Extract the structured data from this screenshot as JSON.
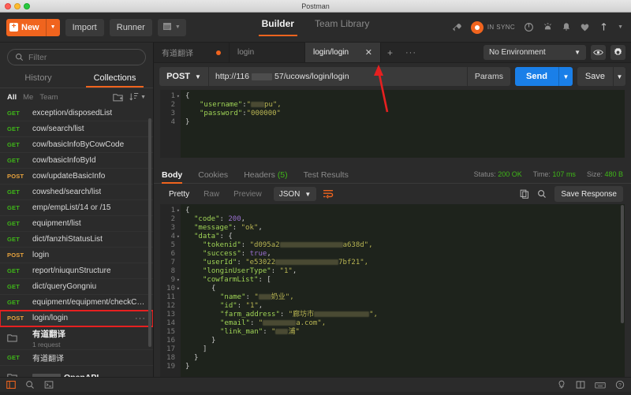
{
  "window": {
    "title": "Postman"
  },
  "topnav": {
    "new_label": "New",
    "import_label": "Import",
    "runner_label": "Runner",
    "tabs": [
      {
        "label": "Builder",
        "active": true
      },
      {
        "label": "Team Library",
        "active": false
      }
    ],
    "sync_status": "IN SYNC",
    "icons": [
      "broadcast-icon",
      "sync-icon",
      "refresh-icon",
      "notification-bell-icon",
      "alarm-bell-icon",
      "heart-icon",
      "upload-icon"
    ]
  },
  "sidebar": {
    "filter_placeholder": "Filter",
    "tabs": [
      {
        "label": "History",
        "active": false
      },
      {
        "label": "Collections",
        "active": true
      }
    ],
    "scope_filters": [
      {
        "label": "All",
        "active": true
      },
      {
        "label": "Me",
        "active": false
      },
      {
        "label": "Team",
        "active": false
      }
    ],
    "items": [
      {
        "type": "request",
        "method": "GET",
        "name": "exception/disposedList"
      },
      {
        "type": "request",
        "method": "GET",
        "name": "cow/search/list"
      },
      {
        "type": "request",
        "method": "GET",
        "name": "cow/basicInfoByCowCode"
      },
      {
        "type": "request",
        "method": "GET",
        "name": "cow/basicInfoById"
      },
      {
        "type": "request",
        "method": "POST",
        "name": "cow/updateBasicInfo"
      },
      {
        "type": "request",
        "method": "GET",
        "name": "cowshed/search/list"
      },
      {
        "type": "request",
        "method": "GET",
        "name": "emp/empList/14 or /15"
      },
      {
        "type": "request",
        "method": "GET",
        "name": "equipment/list"
      },
      {
        "type": "request",
        "method": "GET",
        "name": "dict/fanzhiStatusList"
      },
      {
        "type": "request",
        "method": "POST",
        "name": "login"
      },
      {
        "type": "request",
        "method": "GET",
        "name": "report/niuqunStructure"
      },
      {
        "type": "request",
        "method": "GET",
        "name": "dict/queryGongniu"
      },
      {
        "type": "request",
        "method": "GET",
        "name": "equipment/equipment/checkCowfa..."
      },
      {
        "type": "request",
        "method": "POST",
        "name": "login/login",
        "selected": true,
        "more": "···"
      },
      {
        "type": "folder",
        "name": "有道翻译",
        "subtitle": "1 request"
      },
      {
        "type": "request",
        "method": "GET",
        "name": "有道翻译"
      },
      {
        "type": "folder",
        "name": "OpenAPI",
        "redacted_prefix": true
      }
    ]
  },
  "request": {
    "tabs": [
      {
        "label": "有道翻译",
        "active": false,
        "unsaved": true
      },
      {
        "label": "login",
        "active": false,
        "unsaved": false
      },
      {
        "label": "login/login",
        "active": true,
        "closable": true
      }
    ],
    "add_tab": "+",
    "more_tabs": "···",
    "environment": "No Environment",
    "method": "POST",
    "url": "http://116        57/ucows/login/login",
    "url_prefix": "http://116",
    "url_suffix": "57/ucows/login/login",
    "params_label": "Params",
    "send_label": "Send",
    "save_label": "Save",
    "body_lines": [
      {
        "n": 1,
        "fold": true,
        "text": "{"
      },
      {
        "n": 2,
        "fold": false,
        "text": "    \"username\":\"____pu\","
      },
      {
        "n": 3,
        "fold": false,
        "text": "    \"password\":\"000000\""
      },
      {
        "n": 4,
        "fold": false,
        "text": "}"
      }
    ],
    "body_username_key": "\"username\"",
    "body_password_key": "\"password\"",
    "body_password_value": "\"000000\"",
    "body_username_tail": "pu\","
  },
  "response": {
    "tabs": [
      {
        "label": "Body",
        "active": true
      },
      {
        "label": "Cookies",
        "active": false
      },
      {
        "label": "Headers",
        "count": "(5)",
        "active": false
      },
      {
        "label": "Test Results",
        "active": false
      }
    ],
    "status_label": "Status:",
    "status_value": "200 OK",
    "time_label": "Time:",
    "time_value": "107 ms",
    "size_label": "Size:",
    "size_value": "480 B",
    "formats": [
      {
        "label": "Pretty",
        "active": true
      },
      {
        "label": "Raw",
        "active": false
      },
      {
        "label": "Preview",
        "active": false
      }
    ],
    "language": "JSON",
    "save_response_label": "Save Response",
    "body_lines": [
      {
        "n": 1,
        "fold": true,
        "indent": 0,
        "tokens": [
          {
            "t": "{",
            "c": "p"
          }
        ]
      },
      {
        "n": 2,
        "fold": false,
        "indent": 1,
        "tokens": [
          {
            "t": "\"code\"",
            "c": "k"
          },
          {
            "t": ": ",
            "c": "p"
          },
          {
            "t": "200",
            "c": "n"
          },
          {
            "t": ",",
            "c": "p"
          }
        ]
      },
      {
        "n": 3,
        "fold": false,
        "indent": 1,
        "tokens": [
          {
            "t": "\"message\"",
            "c": "k"
          },
          {
            "t": ": ",
            "c": "p"
          },
          {
            "t": "\"ok\"",
            "c": "s"
          },
          {
            "t": ",",
            "c": "p"
          }
        ]
      },
      {
        "n": 4,
        "fold": true,
        "indent": 1,
        "tokens": [
          {
            "t": "\"data\"",
            "c": "k"
          },
          {
            "t": ": {",
            "c": "p"
          }
        ]
      },
      {
        "n": 5,
        "fold": false,
        "indent": 2,
        "tokens": [
          {
            "t": "\"tokenid\"",
            "c": "k"
          },
          {
            "t": ": ",
            "c": "p"
          },
          {
            "t": "\"d095a2",
            "c": "s"
          },
          {
            "t": "[redacted]",
            "c": "blur"
          },
          {
            "t": "a638d\",",
            "c": "s"
          }
        ]
      },
      {
        "n": 6,
        "fold": false,
        "indent": 2,
        "tokens": [
          {
            "t": "\"success\"",
            "c": "k"
          },
          {
            "t": ": ",
            "c": "p"
          },
          {
            "t": "true",
            "c": "b"
          },
          {
            "t": ",",
            "c": "p"
          }
        ]
      },
      {
        "n": 7,
        "fold": false,
        "indent": 2,
        "tokens": [
          {
            "t": "\"userId\"",
            "c": "k"
          },
          {
            "t": ": ",
            "c": "p"
          },
          {
            "t": "\"e53022",
            "c": "s"
          },
          {
            "t": "[redacted]",
            "c": "blur"
          },
          {
            "t": "7bf21\",",
            "c": "s"
          }
        ]
      },
      {
        "n": 8,
        "fold": false,
        "indent": 2,
        "tokens": [
          {
            "t": "\"longinUserType\"",
            "c": "k"
          },
          {
            "t": ": ",
            "c": "p"
          },
          {
            "t": "\"1\"",
            "c": "s"
          },
          {
            "t": ",",
            "c": "p"
          }
        ]
      },
      {
        "n": 9,
        "fold": true,
        "indent": 2,
        "tokens": [
          {
            "t": "\"cowfarmList\"",
            "c": "k"
          },
          {
            "t": ": [",
            "c": "p"
          }
        ]
      },
      {
        "n": 10,
        "fold": true,
        "indent": 3,
        "tokens": [
          {
            "t": "{",
            "c": "p"
          }
        ]
      },
      {
        "n": 11,
        "fold": false,
        "indent": 4,
        "tokens": [
          {
            "t": "\"name\"",
            "c": "k"
          },
          {
            "t": ": ",
            "c": "p"
          },
          {
            "t": "\"",
            "c": "s"
          },
          {
            "t": "[redacted]",
            "c": "blur"
          },
          {
            "t": "奶业\",",
            "c": "s"
          }
        ]
      },
      {
        "n": 12,
        "fold": false,
        "indent": 4,
        "tokens": [
          {
            "t": "\"id\"",
            "c": "k"
          },
          {
            "t": ": ",
            "c": "p"
          },
          {
            "t": "\"1\"",
            "c": "s"
          },
          {
            "t": ",",
            "c": "p"
          }
        ]
      },
      {
        "n": 13,
        "fold": false,
        "indent": 4,
        "tokens": [
          {
            "t": "\"farm_address\"",
            "c": "k"
          },
          {
            "t": ": ",
            "c": "p"
          },
          {
            "t": "\"廊坊市",
            "c": "s"
          },
          {
            "t": "[redacted]",
            "c": "blur"
          },
          {
            "t": "\",",
            "c": "s"
          }
        ]
      },
      {
        "n": 14,
        "fold": false,
        "indent": 4,
        "tokens": [
          {
            "t": "\"email\"",
            "c": "k"
          },
          {
            "t": ": ",
            "c": "p"
          },
          {
            "t": "\"",
            "c": "s"
          },
          {
            "t": "[redacted]",
            "c": "blur"
          },
          {
            "t": "a.com\",",
            "c": "s"
          }
        ]
      },
      {
        "n": 15,
        "fold": false,
        "indent": 4,
        "tokens": [
          {
            "t": "\"link_man\"",
            "c": "k"
          },
          {
            "t": ": ",
            "c": "p"
          },
          {
            "t": "\"",
            "c": "s"
          },
          {
            "t": "[redacted]",
            "c": "blur"
          },
          {
            "t": "浦\"",
            "c": "s"
          }
        ]
      },
      {
        "n": 16,
        "fold": false,
        "indent": 3,
        "tokens": [
          {
            "t": "}",
            "c": "p"
          }
        ]
      },
      {
        "n": 17,
        "fold": false,
        "indent": 2,
        "tokens": [
          {
            "t": "]",
            "c": "p"
          }
        ]
      },
      {
        "n": 18,
        "fold": false,
        "indent": 1,
        "tokens": [
          {
            "t": "}",
            "c": "p"
          }
        ]
      },
      {
        "n": 19,
        "fold": false,
        "indent": 0,
        "tokens": [
          {
            "t": "}",
            "c": "p"
          }
        ]
      }
    ]
  },
  "statusbar": {
    "left_icons": [
      "sidebar-toggle-icon",
      "search-icon",
      "console-icon"
    ],
    "right_icons": [
      "bulb-icon",
      "layout-icon",
      "keyboard-icon",
      "help-icon"
    ]
  },
  "colors": {
    "accent": "#f0641e",
    "send": "#1a7fe8",
    "get": "#3fb618",
    "post": "#e8a33d",
    "annotation": "#e62020",
    "editor_bg": "#1e231c"
  },
  "annotation": {
    "type": "red-arrow",
    "points_to": "close-tab-button"
  }
}
